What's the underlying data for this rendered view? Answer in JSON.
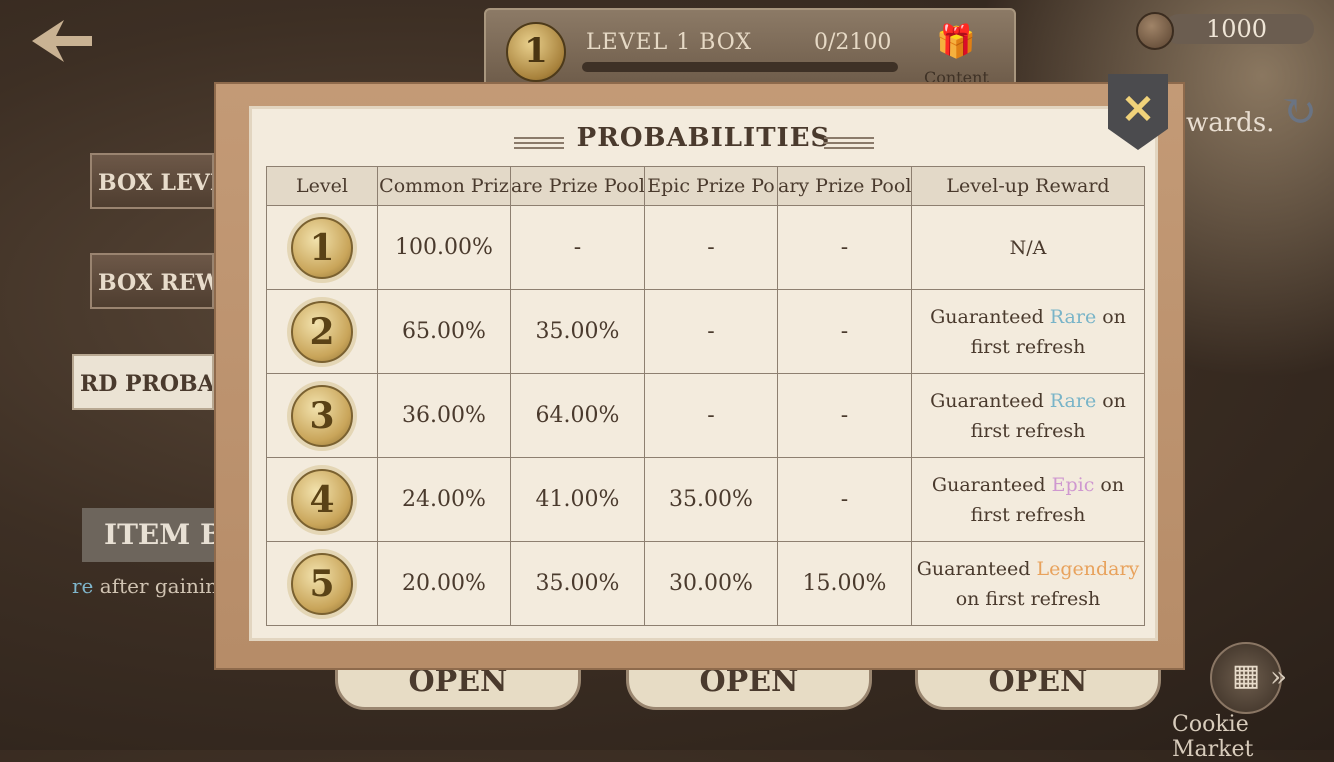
{
  "header": {
    "level_badge": "1",
    "box_title": "LEVEL 1 BOX",
    "progress": "0/2100",
    "content_label": "Content",
    "gift_icon": "gift-icon",
    "progress_fraction": 0
  },
  "currency": {
    "value": "1000",
    "icon": "coin-icon"
  },
  "background": {
    "rewards_text": "wards.",
    "side_tabs": [
      "BOX LEVE",
      "BOX REW",
      "RD PROBA"
    ],
    "item_box_label": "ITEM BO",
    "item_hint_prefix": "re",
    "item_hint_rest": " after gaining",
    "open_buttons": [
      "OPEN",
      "OPEN",
      "OPEN"
    ],
    "market_label": "Cookie Market"
  },
  "modal": {
    "title": "PROBABILITIES",
    "close_icon": "close-icon",
    "columns": [
      "Level",
      "Common Priz",
      "are Prize Pool",
      "Epic Prize Po",
      "ary Prize Pool",
      "Level-up Reward"
    ],
    "rows": [
      {
        "level": "1",
        "common": "100.00%",
        "rare": "-",
        "epic": "-",
        "legendary": "-",
        "reward": {
          "prefix": "N/A",
          "tier": "",
          "tier_class": "",
          "suffix": "",
          "line2": ""
        }
      },
      {
        "level": "2",
        "common": "65.00%",
        "rare": "35.00%",
        "epic": "-",
        "legendary": "-",
        "reward": {
          "prefix": "Guaranteed ",
          "tier": "Rare",
          "tier_class": "rare",
          "suffix": " on",
          "line2": "first refresh"
        }
      },
      {
        "level": "3",
        "common": "36.00%",
        "rare": "64.00%",
        "epic": "-",
        "legendary": "-",
        "reward": {
          "prefix": "Guaranteed ",
          "tier": "Rare",
          "tier_class": "rare",
          "suffix": " on",
          "line2": "first refresh"
        }
      },
      {
        "level": "4",
        "common": "24.00%",
        "rare": "41.00%",
        "epic": "35.00%",
        "legendary": "-",
        "reward": {
          "prefix": "Guaranteed ",
          "tier": "Epic",
          "tier_class": "epic",
          "suffix": " on",
          "line2": "first refresh"
        }
      },
      {
        "level": "5",
        "common": "20.00%",
        "rare": "35.00%",
        "epic": "30.00%",
        "legendary": "15.00%",
        "reward": {
          "prefix": "Guaranteed ",
          "tier": "Legendary",
          "tier_class": "legend",
          "suffix": "",
          "line2": "on first refresh"
        }
      }
    ]
  },
  "colors": {
    "rare": "#79b4c8",
    "epic": "#cf98d0",
    "legendary": "#e8a25c",
    "accent_gold": "#f0d27a"
  }
}
